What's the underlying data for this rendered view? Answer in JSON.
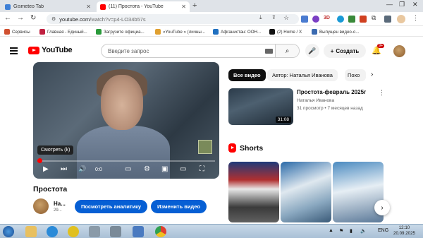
{
  "browser": {
    "tabs": [
      {
        "title": "Gismeteo Tab",
        "active": false
      },
      {
        "title": "(11) Простота - YouTube",
        "active": true
      }
    ],
    "url_host": "youtube.com",
    "url_path": "/watch?v=p4-LO34b57s",
    "bookmarks": [
      "Сервисы",
      "Главная - Единый...",
      "Загрузите официа...",
      "«YouTube » (личны...",
      "Афганистан: ООН...",
      "(2) Home / X",
      "Выпущен видео-о..."
    ],
    "extension_label": "3D"
  },
  "youtube": {
    "logo": "YouTube",
    "search_placeholder": "Введите запрос",
    "create_label": "Создать",
    "notif_badge": "9+"
  },
  "player": {
    "tooltip": "Смотреть (k)",
    "time": "0:0",
    "progress_fraction": 0.01
  },
  "video": {
    "title": "Простота",
    "channel": "На...",
    "subs": "29...",
    "analytics_button": "Посмотреть аналитику",
    "edit_button": "Изменить видео"
  },
  "sidebar": {
    "chips": [
      "Все видео",
      "Автор: Наталья Иванова",
      "Похо"
    ],
    "rec": {
      "title": "Простота-февраль 2025г",
      "channel": "Наталья Иванова",
      "meta": "31 просмотр • 7 месяцев назад",
      "duration": "31:08"
    },
    "shorts_title": "Shorts"
  },
  "taskbar": {
    "lang": "ENG",
    "time": "12:10",
    "date": "20.09.2025"
  },
  "colors": {
    "yt_red": "#ff0000",
    "blue_button": "#065fd4"
  }
}
